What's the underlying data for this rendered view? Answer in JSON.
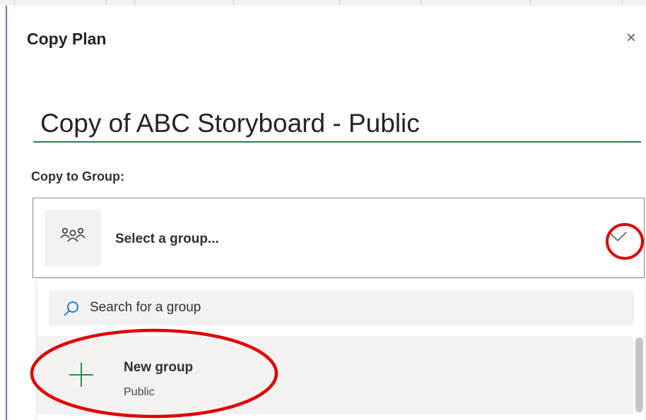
{
  "dialog": {
    "title": "Copy Plan",
    "close_glyph": "×"
  },
  "plan_name": {
    "value": "Copy of ABC Storyboard - Public"
  },
  "group_picker": {
    "label": "Copy to Group:",
    "placeholder": "Select a group...",
    "icon": "group-icon",
    "chevron_icon": "chevron-down-icon"
  },
  "dropdown": {
    "search_placeholder": "Search for a group",
    "search_icon": "search-icon",
    "items": [
      {
        "name": "New group",
        "subtitle": "Public",
        "icon": "plus-icon"
      }
    ]
  },
  "annotations": {
    "color": "#e00000"
  },
  "colors": {
    "accent_green": "#2f7d4f",
    "plus_green": "#2e8b57"
  }
}
